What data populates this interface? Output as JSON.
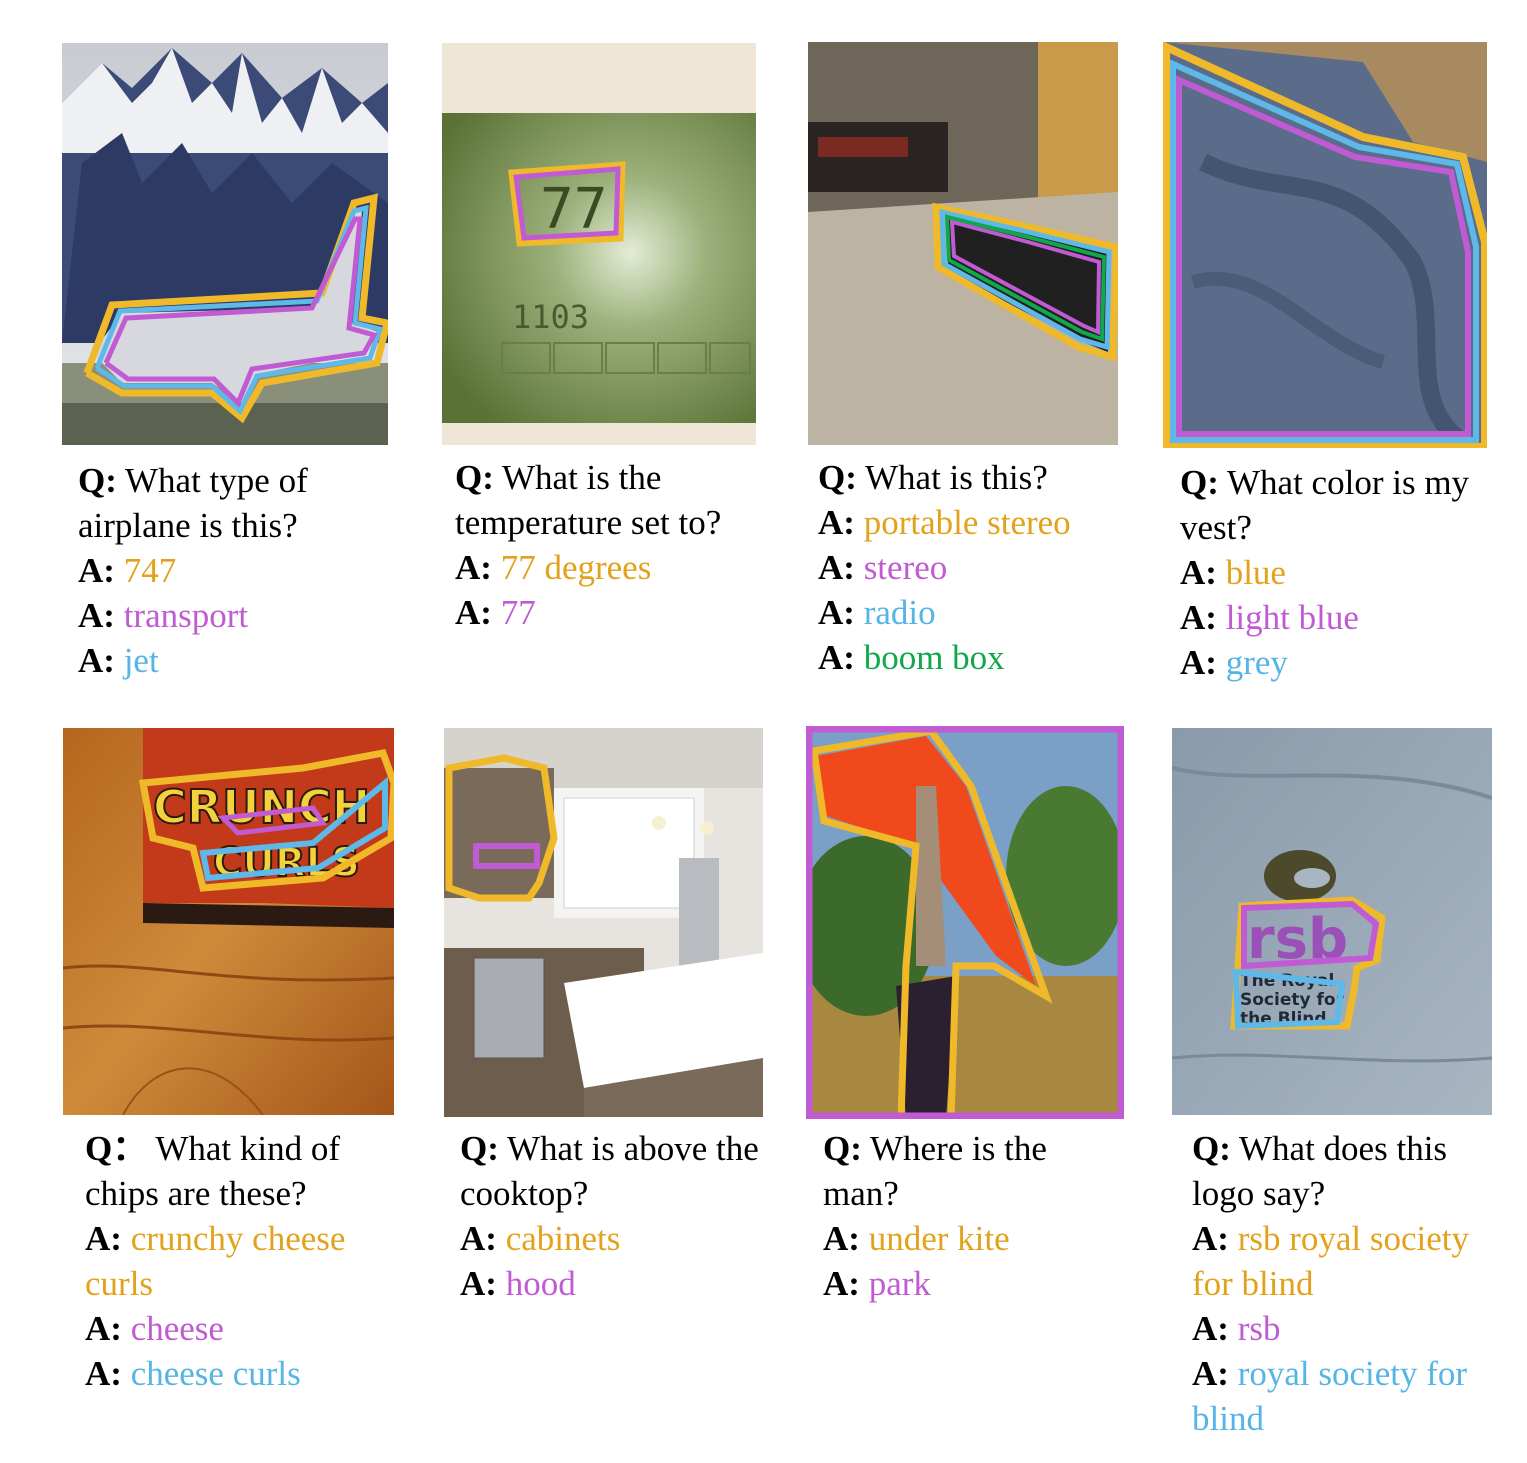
{
  "prefix": {
    "q": "Q:",
    "a": "A:",
    "q_alt": "Q："
  },
  "colors": {
    "gold": "#e2a21c",
    "purple": "#c05bd4",
    "blue": "#54b5e6",
    "green": "#10a84a"
  },
  "panels": [
    {
      "question": "What type of airplane is this?",
      "answers": [
        "747",
        "transport",
        "jet"
      ]
    },
    {
      "question": "What is the temperature set to?",
      "answers": [
        "77 degrees",
        "77"
      ],
      "lcd_top": "77",
      "lcd_bottom": "1103"
    },
    {
      "question": "What is this?",
      "answers": [
        "portable stereo",
        "stereo",
        "radio",
        "boom box"
      ]
    },
    {
      "question": "What color is my vest?",
      "answers": [
        "blue",
        "light blue",
        "grey"
      ]
    },
    {
      "question": "What kind of chips are these?",
      "answers": [
        "crunchy cheese curls",
        "cheese",
        "cheese curls"
      ],
      "bag_line1": "CRUNCH",
      "bag_line2": "CURLS"
    },
    {
      "question": "What is above the cooktop?",
      "answers": [
        "cabinets",
        "hood"
      ]
    },
    {
      "question": "Where is the man?",
      "answers": [
        "under kite",
        "park"
      ]
    },
    {
      "question": "What does this logo say?",
      "answers": [
        "rsb royal society for blind",
        "rsb",
        "royal society for blind"
      ],
      "logo_main": "rsb",
      "logo_sub1": "The Royal",
      "logo_sub2": "Society for",
      "logo_sub3": "the Blind"
    }
  ]
}
